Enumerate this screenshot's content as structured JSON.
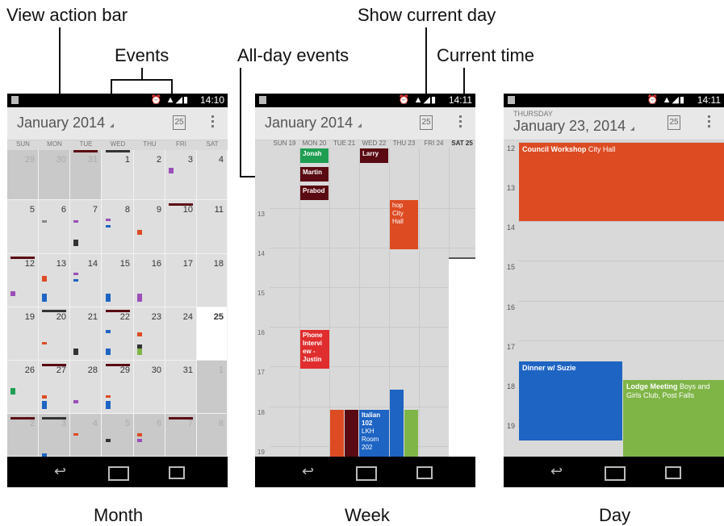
{
  "callouts": {
    "view_action_bar": "View action bar",
    "events": "Events",
    "all_day_events": "All-day events",
    "show_current_day": "Show current day",
    "current_time": "Current time"
  },
  "captions": {
    "month": "Month",
    "week": "Week",
    "day": "Day"
  },
  "month_view": {
    "status_time": "14:10",
    "title": "January 2014",
    "today_icon_label": "25",
    "weekdays": [
      "SUN",
      "MON",
      "TUE",
      "WED",
      "THU",
      "FRI",
      "SAT"
    ],
    "weeks": [
      [
        "29",
        "30",
        "31",
        "1",
        "2",
        "3",
        "4"
      ],
      [
        "5",
        "6",
        "7",
        "8",
        "9",
        "10",
        "11"
      ],
      [
        "12",
        "13",
        "14",
        "15",
        "16",
        "17",
        "18"
      ],
      [
        "19",
        "20",
        "21",
        "22",
        "23",
        "24",
        "25"
      ],
      [
        "26",
        "27",
        "28",
        "29",
        "30",
        "31",
        "1"
      ],
      [
        "2",
        "3",
        "4",
        "5",
        "6",
        "7",
        "8"
      ]
    ],
    "today": "25"
  },
  "week_view": {
    "status_time": "14:11",
    "title": "January 2014",
    "today_icon_label": "25",
    "days": [
      "SUN 19",
      "MON 20",
      "TUE 21",
      "WED 22",
      "THU 23",
      "FRI 24",
      "SAT 25"
    ],
    "hours": [
      "13",
      "14",
      "15",
      "16",
      "17",
      "18",
      "19"
    ],
    "events": {
      "jonah": "Jonah",
      "martin": "Martin",
      "prabod": "Prabod",
      "larry": "Larry",
      "workshop": "hop City Hall",
      "phone": "Phone Intervi ew - Justin",
      "italian_title": "Italian 102",
      "italian_loc": "LKH Room 202"
    }
  },
  "day_view": {
    "status_time": "14:11",
    "weekday": "THURSDAY",
    "title": "January 23, 2014",
    "today_icon_label": "25",
    "hours": [
      "12",
      "13",
      "14",
      "15",
      "16",
      "17",
      "18",
      "19"
    ],
    "events": {
      "council_title": "Council Workshop",
      "council_loc": "City Hall",
      "dinner": "Dinner w/ Suzie",
      "lodge_title": "Lodge Meeting",
      "lodge_loc": "Boys and Girls Club, Post Falls"
    }
  },
  "colors": {
    "orange": "#dd4b22",
    "dark_red": "#5a0a12",
    "green": "#1f9e52",
    "blue": "#1e64c3",
    "lime": "#7fb547",
    "purple": "#9b4fb7",
    "red": "#e02d2d",
    "today_bg": "#ffffff"
  }
}
